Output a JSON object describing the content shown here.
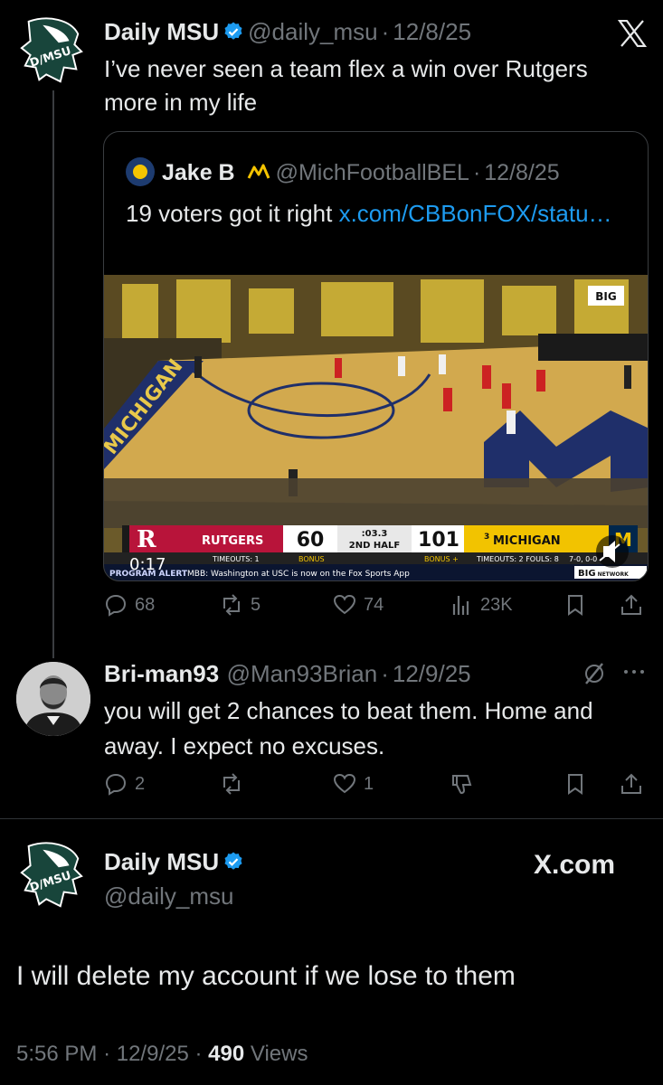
{
  "tweet1": {
    "name": "Daily MSU",
    "handle": "@daily_msu",
    "sep": "·",
    "date": "12/8/25",
    "avatar_text": "D/MSU",
    "text": "I’ve never seen a team flex a win over Rutgers more in my life",
    "quote": {
      "name": "Jake B",
      "handle": "@MichFootballBEL",
      "sep": "·",
      "date": "12/8/25",
      "text_prefix": "19 voters got it right ",
      "link": "x.com/CBBonFOX/statu…",
      "video": {
        "elapsed": "0:17",
        "home_team": "RUTGERS",
        "home_score": "60",
        "clock": ":03.3",
        "period": "2ND HALF",
        "away_score": "101",
        "away_team": "MICHIGAN",
        "away_rank": "3",
        "home_timeouts": "TIMEOUTS: 1",
        "home_bonus": "BONUS",
        "away_bonus": "BONUS +",
        "away_timeouts": "TIMEOUTS: 2  FOULS: 8",
        "away_record": "7-0, 0-0",
        "ticker_label": "PROGRAM ALERT",
        "ticker_text": "MBB: Washington at USC is now on the Fox Sports App",
        "court_text": "MICHIGAN",
        "network": "BIG",
        "network_sub": "NETWORK"
      }
    },
    "actions": {
      "replies": "68",
      "reposts": "5",
      "likes": "74",
      "views": "23K"
    }
  },
  "tweet2": {
    "name": "Bri-man93",
    "handle": "@Man93Brian",
    "sep": "·",
    "date": "12/9/25",
    "text": "you will get 2 chances to beat them. Home and away. I expect no excuses.",
    "actions": {
      "replies": "2",
      "reposts": "",
      "likes": "1"
    }
  },
  "tweet3": {
    "name": "Daily MSU",
    "handle": "@daily_msu",
    "avatar_text": "D/MSU",
    "brand": "X.com",
    "text": "I will delete my account if we lose to them",
    "time": "5:56 PM",
    "sep": "·",
    "date": "12/9/25",
    "views_count": "490",
    "views_label": "Views"
  },
  "colors": {
    "background": "#000000",
    "text": "#e7e9ea",
    "muted": "#71767b",
    "link": "#1d9bf0",
    "verified": "#1d9bf0",
    "msu_green": "#18453b"
  }
}
